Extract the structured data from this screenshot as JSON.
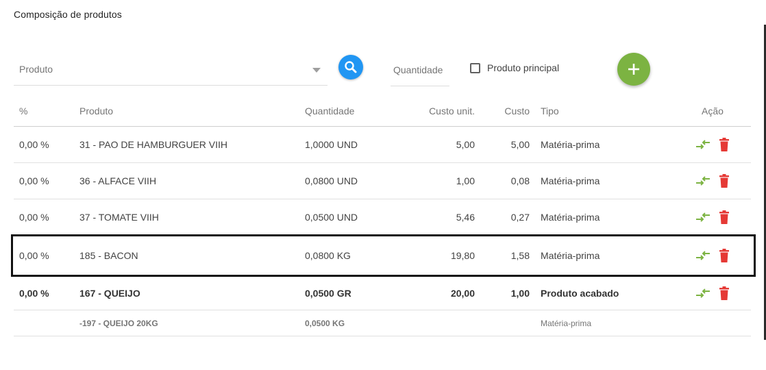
{
  "section": {
    "title": "Composição de produtos"
  },
  "filters": {
    "product_placeholder": "Produto",
    "quantity_placeholder": "Quantidade",
    "main_product_label": "Produto principal"
  },
  "table": {
    "headers": {
      "percent": "%",
      "product": "Produto",
      "quantity": "Quantidade",
      "unit_cost": "Custo unit.",
      "cost": "Custo",
      "type": "Tipo",
      "action": "Ação"
    },
    "rows": [
      {
        "percent": "0,00 %",
        "product": "31 - PAO DE HAMBURGUER VIIH",
        "quantity": "1,0000 UND",
        "unit_cost": "5,00",
        "cost": "5,00",
        "type": "Matéria-prima"
      },
      {
        "percent": "0,00 %",
        "product": "36 - ALFACE VIIH",
        "quantity": "0,0800 UND",
        "unit_cost": "1,00",
        "cost": "0,08",
        "type": "Matéria-prima"
      },
      {
        "percent": "0,00 %",
        "product": "37 - TOMATE VIIH",
        "quantity": "0,0500 UND",
        "unit_cost": "5,46",
        "cost": "0,27",
        "type": "Matéria-prima"
      },
      {
        "percent": "0,00 %",
        "product": "185 - BACON",
        "quantity": "0,0800 KG",
        "unit_cost": "19,80",
        "cost": "1,58",
        "type": "Matéria-prima"
      },
      {
        "percent": "0,00 %",
        "product": "167 - QUEIJO",
        "quantity": "0,0500 GR",
        "unit_cost": "20,00",
        "cost": "1,00",
        "type": "Produto acabado"
      }
    ],
    "sub_row": {
      "product": "-197 - QUEIJO 20KG",
      "quantity": "0,0500 KG",
      "type": "Matéria-prima"
    }
  },
  "colors": {
    "search_button": "#2196f3",
    "add_button": "#7cb342",
    "swap_icon": "#7cb342",
    "delete_icon": "#e53935"
  }
}
